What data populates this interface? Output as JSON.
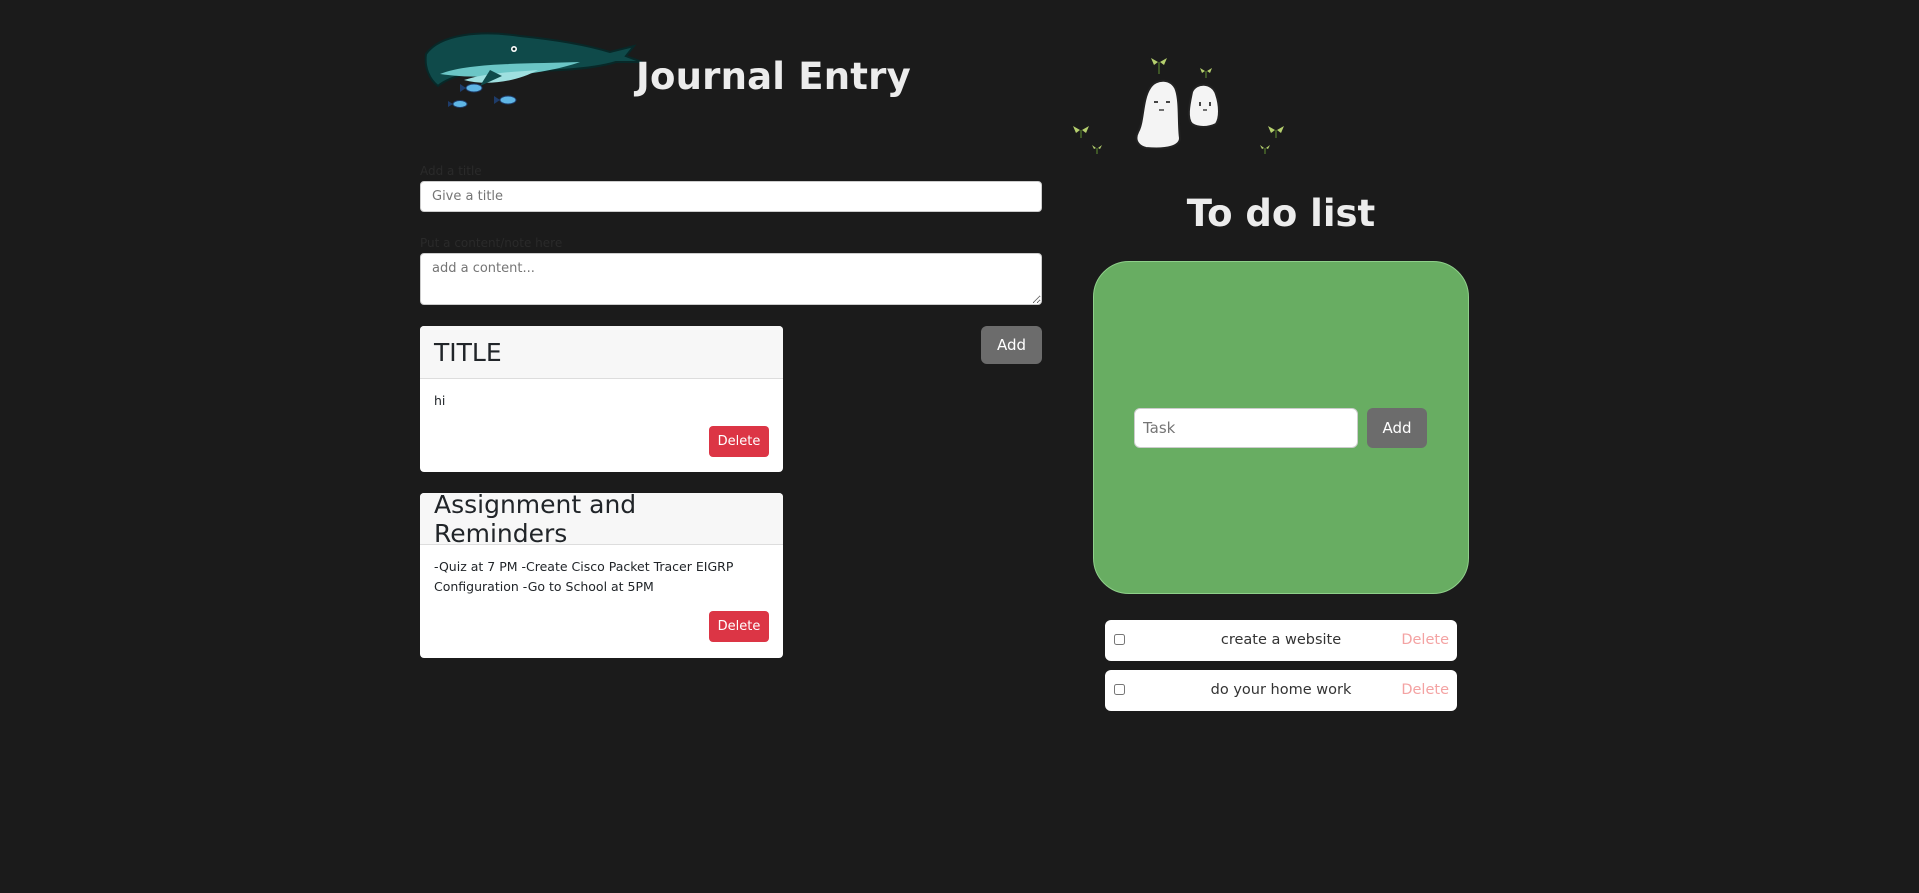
{
  "journal": {
    "title": "Journal Entry",
    "title_label": "Add a title",
    "title_placeholder": "Give a title",
    "content_label": "Put a content/note here",
    "content_placeholder": "add a content...",
    "add_label": "Add",
    "entries": [
      {
        "title": "TITLE",
        "body": "hi",
        "delete_label": "Delete"
      },
      {
        "title": "Assignment and Reminders",
        "body": "-Quiz at 7 PM -Create Cisco Packet Tracer EIGRP Configuration -Go to School at 5PM",
        "delete_label": "Delete"
      }
    ]
  },
  "todo": {
    "title": "To do list",
    "task_placeholder": "Task",
    "add_label": "Add",
    "tasks": [
      {
        "text": "create a website",
        "checked": false,
        "delete_label": "Delete"
      },
      {
        "text": "do your home work",
        "checked": false,
        "delete_label": "Delete"
      }
    ]
  },
  "colors": {
    "background": "#1b1b1b",
    "todo_panel": "#68ad62",
    "delete_button": "#dc3545",
    "add_button": "#6c6c6c",
    "task_delete_text": "#f4a3a3"
  },
  "icons": {
    "header_left": "whale-with-fish-pixel-art",
    "header_right": "ghosts-with-sprouts-pixel-art"
  }
}
